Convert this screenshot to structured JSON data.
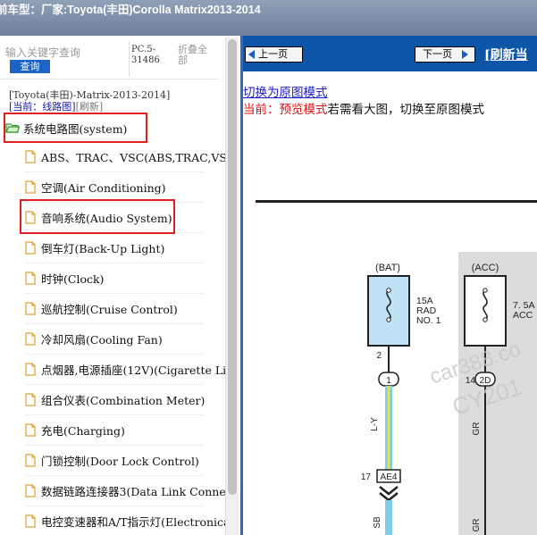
{
  "title": "前车型：厂家:Toyota(丰田)Corolla Matrix2013-2014",
  "left": {
    "search_placeholder": "输入关键字查询",
    "search_button": "查询",
    "pc_label": "PC.5-31486",
    "collapse_all": "折叠全部",
    "path": "[Toyota(丰田)-Matrix-2013-2014]",
    "current_prefix": "[当前：",
    "current_mode": "线路图",
    "current_suffix": "]",
    "refresh": "[刷新]",
    "root_label": "系统电路图(system)",
    "items": [
      "ABS、TRAC、VSC(ABS,TRAC,VSC",
      "空调(Air Conditioning)",
      "音响系统(Audio System)",
      "倒车灯(Back-Up Light)",
      "时钟(Clock)",
      "巡航控制(Cruise Control)",
      "冷却风扇(Cooling Fan)",
      "点烟器,电源插座(12V)(Cigarette Lig",
      "组合仪表(Combination Meter)",
      "充电(Charging)",
      "门锁控制(Door Lock Control)",
      "数据链路连接器3(Data Link Connec",
      "电控变速器和A/T指示灯(Electronica"
    ]
  },
  "right": {
    "prev_label": "上一页",
    "next_label": "下一页",
    "refresh_label": "[刷新当",
    "switch_link": "切换为原图模式",
    "mode_prefix": "当前：预览模式",
    "mode_suffix": "若需看大图，切换至原图模式",
    "diagram": {
      "bat_label": "(BAT)",
      "acc_label": "(ACC)",
      "fuse1_amp": "15A",
      "fuse1_name1": "RAD",
      "fuse1_name2": "NO. 1",
      "fuse2_amp": "7. 5A",
      "fuse2_name": "ACC",
      "pin1_num": "2",
      "pin1_conn": "1",
      "pin2_num": "14",
      "pin2_conn": "2D",
      "wire1": "L-Y",
      "wire2": "GR",
      "wire3": "GR",
      "ae4_num": "17",
      "ae4_label": "AE4",
      "sb_label": "SB",
      "watermark1": "car388.co",
      "watermark2": "CY201"
    }
  }
}
